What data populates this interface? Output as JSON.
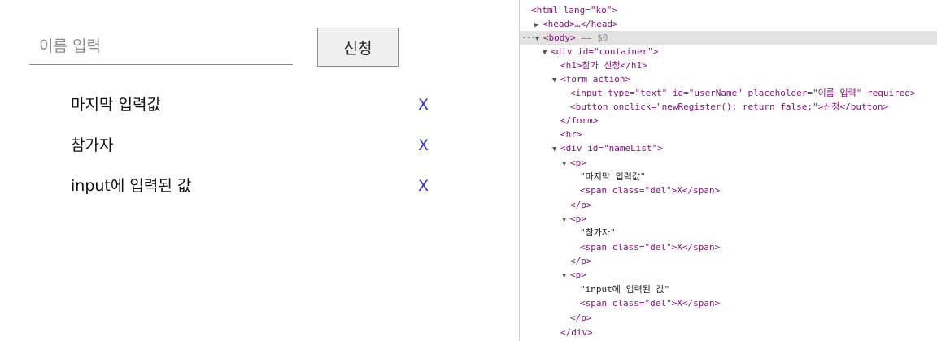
{
  "form": {
    "name_placeholder": "이름 입력",
    "submit_label": "신청"
  },
  "names": [
    {
      "text": "마지막 입력값",
      "delete_label": "X"
    },
    {
      "text": "참가자",
      "delete_label": "X"
    },
    {
      "text": "input에 입력된 값",
      "delete_label": "X"
    }
  ],
  "devtools": {
    "html_open": "<html lang=\"ko\">",
    "head": "<head>…</head>",
    "body_dots": "···",
    "body_tag": "<body>",
    "body_eq": "== $0",
    "container_open": "<div id=\"container\">",
    "h1": "<h1>참가 신청</h1>",
    "form_open": "<form action>",
    "input_tag": "<input type=\"text\" id=\"userName\" placeholder=\"이름 입력\" required>",
    "button_tag": "<button onclick=\"newRegister(); return false;\">신청</button>",
    "form_close": "</form>",
    "hr": "<hr>",
    "namelist_open": "<div id=\"nameList\">",
    "p_open": "<p>",
    "p_close": "</p>",
    "span_del": "<span class=\"del\">X</span>",
    "p1_text": "\"마지막 입력값\"",
    "p2_text": "\"참가자\"",
    "p3_text": "\"input에 입력된 값\"",
    "div_close": "</div>"
  },
  "colors": {
    "delete_x": "#3333cc",
    "devtools_tag": "#881280",
    "devtools_attr_name": "#994500",
    "devtools_attr_value": "#1a1aa6",
    "selected_row": "#e2e2e2"
  }
}
